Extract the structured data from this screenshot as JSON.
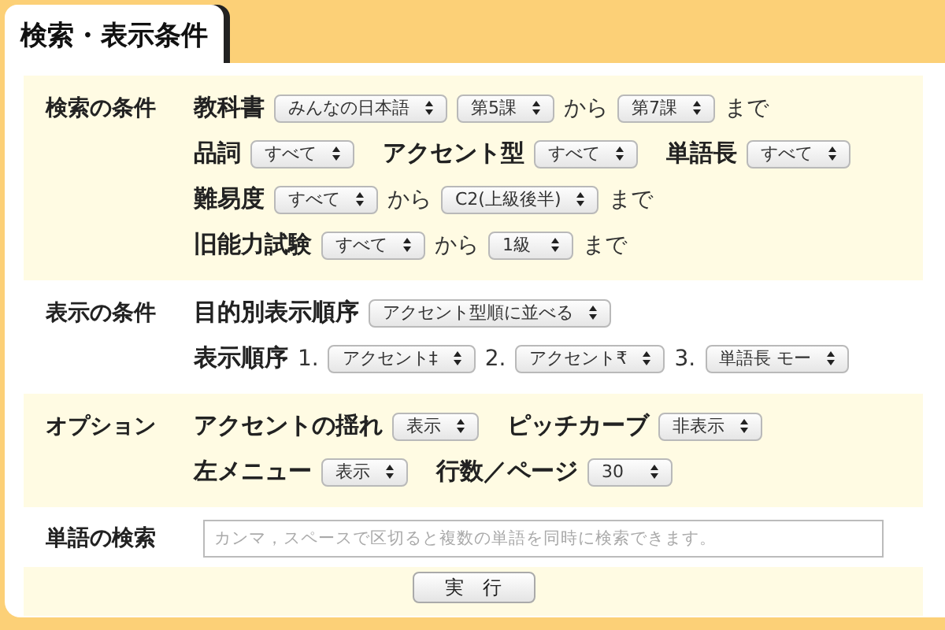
{
  "tab": {
    "label": "検索・表示条件"
  },
  "sections": [
    {
      "title": "検索の条件",
      "lines": [
        {
          "parts": [
            {
              "kind": "label",
              "text": "教科書"
            },
            {
              "kind": "select",
              "value": "みんなの日本語"
            },
            {
              "kind": "select",
              "value": "第5課"
            },
            {
              "kind": "text",
              "text": "から"
            },
            {
              "kind": "select",
              "value": "第7課"
            },
            {
              "kind": "text",
              "text": "まで"
            }
          ]
        },
        {
          "parts": [
            {
              "kind": "label",
              "text": "品詞"
            },
            {
              "kind": "select",
              "value": "すべて"
            },
            {
              "kind": "label",
              "text": "アクセント型"
            },
            {
              "kind": "select",
              "value": "すべて"
            },
            {
              "kind": "label",
              "text": "単語長"
            },
            {
              "kind": "select",
              "value": "すべて"
            }
          ]
        },
        {
          "parts": [
            {
              "kind": "label",
              "text": "難易度"
            },
            {
              "kind": "select",
              "value": "すべて"
            },
            {
              "kind": "text",
              "text": "から"
            },
            {
              "kind": "select",
              "value": "C2(上級後半)"
            },
            {
              "kind": "text",
              "text": "まで"
            }
          ]
        },
        {
          "parts": [
            {
              "kind": "label",
              "text": "旧能力試験"
            },
            {
              "kind": "select",
              "value": "すべて"
            },
            {
              "kind": "text",
              "text": "から"
            },
            {
              "kind": "select",
              "value": "1級"
            },
            {
              "kind": "text",
              "text": "まで"
            }
          ]
        }
      ]
    },
    {
      "title": "表示の条件",
      "lines": [
        {
          "parts": [
            {
              "kind": "label",
              "text": "目的別表示順序"
            },
            {
              "kind": "select",
              "value": "アクセント型順に並べる"
            }
          ]
        },
        {
          "parts": [
            {
              "kind": "label",
              "text": "表示順序"
            },
            {
              "kind": "text",
              "text": "1."
            },
            {
              "kind": "select",
              "value": "アクセント‡"
            },
            {
              "kind": "text",
              "text": "2."
            },
            {
              "kind": "select",
              "value": "アクセント₹"
            },
            {
              "kind": "text",
              "text": "3."
            },
            {
              "kind": "select",
              "value": "単語長 モー"
            }
          ]
        }
      ]
    },
    {
      "title": "オプション",
      "lines": [
        {
          "parts": [
            {
              "kind": "label",
              "text": "アクセントの揺れ"
            },
            {
              "kind": "select",
              "value": "表示"
            },
            {
              "kind": "label",
              "text": "ピッチカーブ"
            },
            {
              "kind": "select",
              "value": "非表示"
            }
          ]
        },
        {
          "parts": [
            {
              "kind": "label",
              "text": "左メニュー"
            },
            {
              "kind": "select",
              "value": "表示"
            },
            {
              "kind": "label",
              "text": "行数／ページ"
            },
            {
              "kind": "select",
              "value": "30"
            }
          ]
        }
      ]
    }
  ],
  "word_search": {
    "title": "単語の検索",
    "placeholder": "カンマ，スペースで区切ると複数の単語を同時に検索できます。"
  },
  "submit": {
    "label": "実　行"
  }
}
